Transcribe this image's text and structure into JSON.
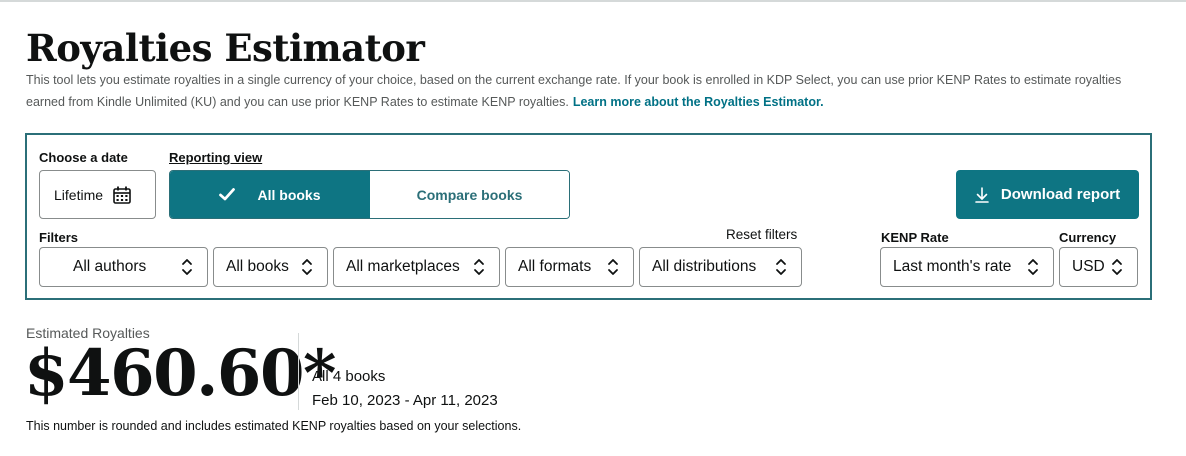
{
  "header": {
    "title": "Royalties Estimator",
    "description": "This tool lets you estimate royalties in a single currency of your choice, based on the current exchange rate. If your book is enrolled in KDP Select, you can use prior KENP Rates to estimate royalties earned from Kindle Unlimited (KU) and you can use prior KENP Rates to estimate KENP royalties.",
    "learn_more_link": "Learn more about the Royalties Estimator."
  },
  "controls": {
    "date_label": "Choose a date",
    "date_value": "Lifetime",
    "reporting_view_label": "Reporting view",
    "reporting_view_options": [
      "All books",
      "Compare books"
    ],
    "reporting_view_selected": "All books",
    "download_button": "Download report",
    "filters_label": "Filters",
    "reset_filters": "Reset filters",
    "filters": {
      "authors": "All authors",
      "books": "All books",
      "marketplaces": "All marketplaces",
      "formats": "All formats",
      "distributions": "All distributions"
    },
    "kenp_rate_label": "KENP Rate",
    "kenp_rate_value": "Last month's rate",
    "currency_label": "Currency",
    "currency_value": "USD"
  },
  "summary": {
    "label": "Estimated Royalties",
    "amount": "$460.60*",
    "books": "All 4 books",
    "date_range": "Feb 10, 2023 - Apr 11, 2023",
    "note": "This number is rounded and includes estimated KENP royalties based on your selections."
  },
  "colors": {
    "accent": "#0e7583",
    "panel_border": "#2b6f78",
    "link": "#007185",
    "muted_text": "#565959"
  },
  "icons": {
    "date": "calendar-icon",
    "selected_view": "checkmark-icon",
    "download": "download-arrow-icon",
    "dropdown": "chevron-up-down-icon"
  }
}
